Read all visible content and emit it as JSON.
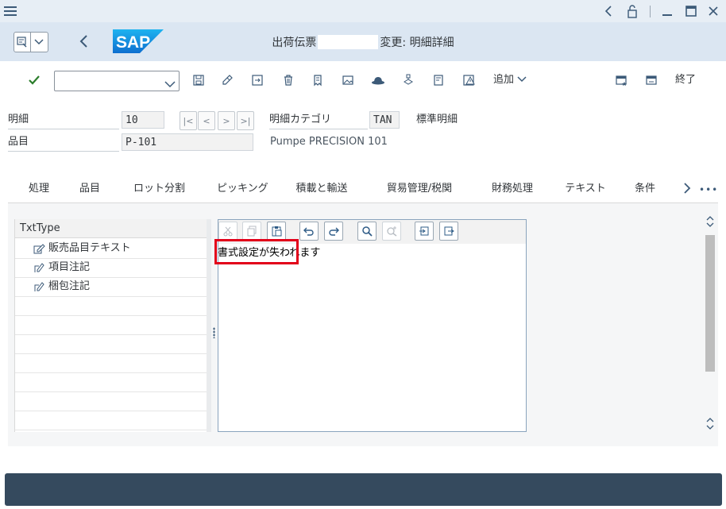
{
  "window": {
    "icons": [
      "hamburger-icon",
      "back-arrow-icon",
      "lock-icon",
      "minimize-icon",
      "maximize-icon",
      "close-icon"
    ]
  },
  "shell": {
    "brand": "SAP",
    "title_prefix": "出荷伝票",
    "title_suffix": "変更: 明細詳細",
    "colors": {
      "brand_blue": "#1d8ddb",
      "shell_bg": "#dbe6f2",
      "footer": "#354a5e",
      "highlight": "#e2001a"
    }
  },
  "toolbar": {
    "command_value": "",
    "add_label": "追加",
    "exit_label": "終了"
  },
  "header": {
    "item_label": "明細",
    "item_value": "10",
    "material_label": "品目",
    "material_value": "P-101",
    "material_desc": "Pumpe PRECISION 101",
    "category_label": "明細カテゴリ",
    "category_value": "TAN",
    "category_desc": "標準明細"
  },
  "tabs": [
    {
      "label": "処理"
    },
    {
      "label": "品目"
    },
    {
      "label": "ロット分割"
    },
    {
      "label": "ピッキング"
    },
    {
      "label": "積載と輸送"
    },
    {
      "label": "貿易管理/税関"
    },
    {
      "label": "財務処理"
    },
    {
      "label": "テキスト"
    },
    {
      "label": "条件"
    }
  ],
  "active_tab": "テキスト",
  "tree": {
    "header": "TxtType",
    "items": [
      {
        "label": "販売品目テキスト"
      },
      {
        "label": "項目注記"
      },
      {
        "label": "梱包注記"
      }
    ]
  },
  "editor": {
    "text": "書式設定が失われます"
  }
}
